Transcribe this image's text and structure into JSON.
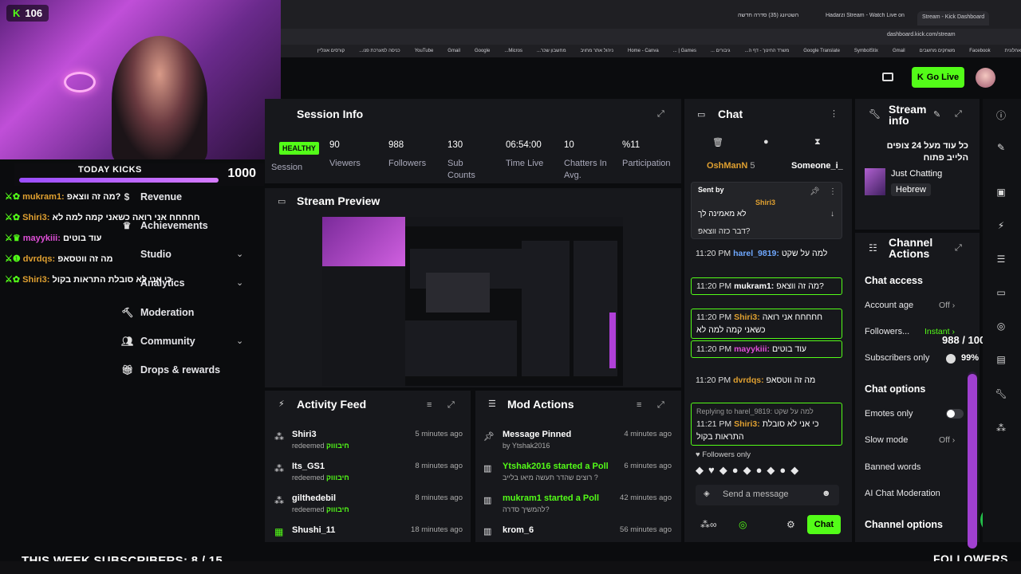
{
  "browser": {
    "tabs": [
      "השטיונג (35) סדרה חדשה",
      "Hadarzi Stream - Watch Live on",
      "Stream - Kick Dashboard"
    ],
    "url": "dashboard.kick.com/stream",
    "bookmarks": [
      "קורסים אונליין",
      "כניסה למערכת פנו...",
      "YouTube",
      "Gmail",
      "Google",
      "Micros...",
      "מחשבון שכר...",
      "ניהול אתר מחויב",
      "Home - Canva",
      "Games | ...",
      "גיבורים ...",
      "משרד החינוך - דף ה...",
      "Google Translate",
      "SymbolStix",
      "Gmail",
      "משחקים מחשבים",
      "Facebook",
      "אחלונית"
    ]
  },
  "header": {
    "go_live": "Go Live"
  },
  "webcam": {
    "kicks_count": "106"
  },
  "today_kicks": {
    "label": "TODAY KICKS",
    "value": "1000",
    "progress": 1.0
  },
  "overlay_chat": [
    {
      "user": "mukram1:",
      "msg": "מה זה ווצאפ?"
    },
    {
      "user": "Shiri3:",
      "msg": "חחחחח אני רואה כשאני קמה למה לא"
    },
    {
      "user": "mayykiii:",
      "msg": "עוד בוטים"
    },
    {
      "user": "dvrdqs:",
      "msg": "מה זה ווטסאפ"
    },
    {
      "user": "Shiri3:",
      "msg": "כי אני לא סובלת התראות בקול"
    }
  ],
  "sidebar": {
    "items": [
      {
        "label": "Revenue"
      },
      {
        "label": "Achievements"
      },
      {
        "label": "Studio"
      },
      {
        "label": "Analytics"
      },
      {
        "label": "Moderation"
      },
      {
        "label": "Community"
      },
      {
        "label": "Drops & rewards"
      }
    ]
  },
  "session": {
    "title": "Session Info",
    "health": "HEALTHY",
    "health_label": "Session",
    "stats": [
      {
        "value": "90",
        "label": "Viewers"
      },
      {
        "value": "988",
        "label": "Followers"
      },
      {
        "value": "130",
        "label": "Sub Counts"
      },
      {
        "value": "06:54:00",
        "label": "Time Live"
      },
      {
        "value": "10",
        "label": "Chatters In Avg."
      },
      {
        "value": "%11",
        "label": "Participation"
      }
    ]
  },
  "preview": {
    "title": "Stream Preview"
  },
  "activity": {
    "title": "Activity Feed",
    "rows": [
      {
        "name": "Shiri3",
        "action": "redeemed",
        "reward": "חיבוווק",
        "time": "5 minutes ago"
      },
      {
        "name": "Its_GS1",
        "action": "redeemed",
        "reward": "חיבוווק",
        "time": "8 minutes ago"
      },
      {
        "name": "gilthedebil",
        "action": "redeemed",
        "reward": "חיבוווק",
        "time": "8 minutes ago"
      },
      {
        "name": "Shushi_11",
        "action": "",
        "reward": "",
        "time": "18 minutes ago"
      }
    ]
  },
  "mod": {
    "title": "Mod Actions",
    "rows": [
      {
        "name": "Message Pinned",
        "sub": "by Ytshak2016",
        "time": "4 minutes ago"
      },
      {
        "name": "Ytshak2016 started a Poll",
        "sub": "רוצים שהדר תעשה מיאו בלייב ?",
        "time": "6 minutes ago"
      },
      {
        "name": "mukram1 started a Poll",
        "sub": "להמשיך סדרה?",
        "time": "42 minutes ago"
      },
      {
        "name": "krom_6",
        "sub": "",
        "time": "56 minutes ago"
      }
    ]
  },
  "chat": {
    "title": "Chat",
    "top_users": [
      {
        "name": "OshManN",
        "count": "5"
      },
      {
        "name": "Someone_i_"
      }
    ],
    "pinned": {
      "label": "Sent by",
      "user": "Shiri3",
      "msg": "לא מאמינה לך"
    },
    "pinned_tail": "דבר כזה ווצאפ?",
    "messages": [
      {
        "time": "11:20 PM",
        "user": "harel_9819:",
        "text": "למה על שקט",
        "color": "#6fa8ff",
        "hl": false
      },
      {
        "time": "11:20 PM",
        "user": "mukram1:",
        "text": "מה זה ווצאפ?",
        "color": "#ffffff",
        "hl": true
      },
      {
        "time": "11:20 PM",
        "user": "Shiri3:",
        "text": "חחחחח אני רואה כשאני קמה למה לא",
        "color": "#e0a030",
        "hl": true
      },
      {
        "time": "11:20 PM",
        "user": "mayykiii:",
        "text": "עוד בוטים",
        "color": "#e04fd8",
        "hl": true
      },
      {
        "time": "11:20 PM",
        "user": "dvrdqs:",
        "text": "מה זה ווטסאפ",
        "color": "#e0a030",
        "hl": false
      },
      {
        "time": "11:21 PM",
        "user": "Shiri3:",
        "text": "כי אני לא סובלת התראות בקול",
        "color": "#e0a030",
        "hl": true,
        "reply": "Replying to harel_9819: למה על שקט"
      }
    ],
    "followers_only": "Followers only",
    "send_placeholder": "Send a message",
    "chat_button": "Chat"
  },
  "stream_info": {
    "title": "Stream info",
    "stream_title": "כל עוד מעל 24 צופים הלייב פתוח",
    "category": "Just Chatting",
    "tag": "Hebrew"
  },
  "channel_actions": {
    "title": "Channel Actions",
    "chat_access": "Chat access",
    "rows": [
      {
        "label": "Account age",
        "value": "Off"
      },
      {
        "label": "Followers...",
        "value": "Instant"
      },
      {
        "label": "Subscribers only",
        "value": "99%"
      }
    ],
    "chat_options": "Chat options",
    "options": [
      {
        "label": "Emotes only",
        "value": ""
      },
      {
        "label": "Slow mode",
        "value": "Off"
      },
      {
        "label": "Banned words",
        "value": ""
      },
      {
        "label": "AI Chat Moderation",
        "value": ""
      }
    ],
    "channel_options": "Channel options"
  },
  "followers_goal": {
    "text": "988 / 1000",
    "label": "FOLLOWERS",
    "progress": 0.988
  },
  "overlay_bottom": {
    "subs": "THIS WEEK SUBSCRIBERS: 8 / 15"
  }
}
